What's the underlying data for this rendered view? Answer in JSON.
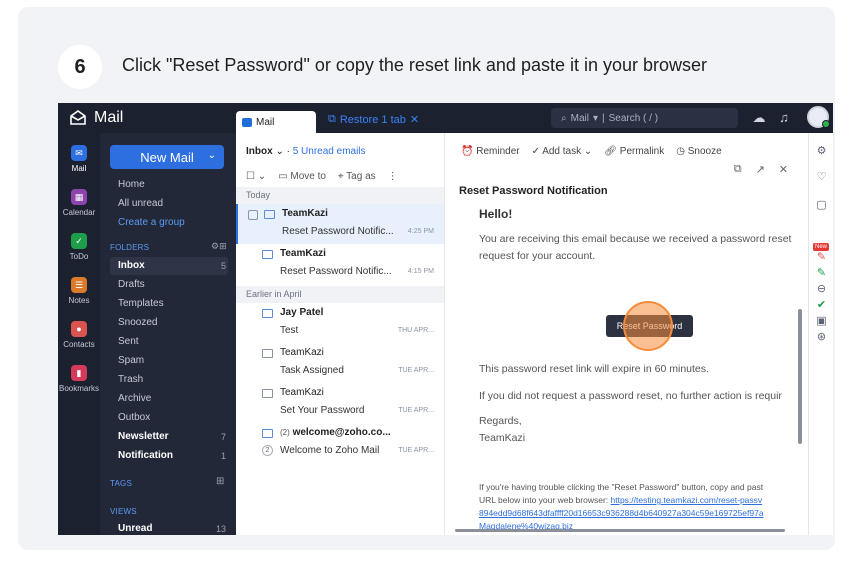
{
  "step": {
    "number": "6",
    "instruction": "Click \"Reset Password\" or copy the reset link and paste it in your browser"
  },
  "topbar": {
    "brand": "Mail",
    "tab_mail": "Mail",
    "tab_restore": "Restore 1 tab",
    "search_scope": "Mail",
    "search_placeholder": "Search ( / )"
  },
  "rail": [
    {
      "label": "Mail",
      "icon": "mail-icon",
      "color": "#2e6fe0"
    },
    {
      "label": "Calendar",
      "icon": "calendar-icon",
      "color": "#8e44ad"
    },
    {
      "label": "ToDo",
      "icon": "todo-icon",
      "color": "#1e9e4a"
    },
    {
      "label": "Notes",
      "icon": "notes-icon",
      "color": "#d97b2b"
    },
    {
      "label": "Contacts",
      "icon": "contacts-icon",
      "color": "#d9534f"
    },
    {
      "label": "Bookmarks",
      "icon": "bookmark-icon",
      "color": "#d63a5a"
    }
  ],
  "folders": {
    "new_mail": "New Mail",
    "top_items": [
      "Home",
      "All unread",
      "Create a group"
    ],
    "section_folders": "FOLDERS",
    "items": [
      {
        "label": "Inbox",
        "count": "5"
      },
      {
        "label": "Drafts",
        "count": ""
      },
      {
        "label": "Templates",
        "count": ""
      },
      {
        "label": "Snoozed",
        "count": ""
      },
      {
        "label": "Sent",
        "count": ""
      },
      {
        "label": "Spam",
        "count": ""
      },
      {
        "label": "Trash",
        "count": ""
      },
      {
        "label": "Archive",
        "count": ""
      },
      {
        "label": "Outbox",
        "count": ""
      },
      {
        "label": "Newsletter",
        "count": "7"
      },
      {
        "label": "Notification",
        "count": "1"
      }
    ],
    "section_tags": "TAGS",
    "section_views": "VIEWS",
    "views": [
      {
        "label": "Unread",
        "count": "13"
      }
    ]
  },
  "list": {
    "folder": "Inbox",
    "unread": "5 Unread emails",
    "move_to": "Move to",
    "tag_as": "Tag as",
    "group_today": "Today",
    "group_april": "Earlier in April",
    "rows": [
      {
        "from": "TeamKazi",
        "subject": "Reset Password Notific...",
        "time": "4:25 PM",
        "bold": true
      },
      {
        "from": "TeamKazi",
        "subject": "Reset Password Notific...",
        "time": "4:15 PM",
        "bold": true
      },
      {
        "from": "Jay Patel",
        "subject": "Test",
        "time": "THU APR...",
        "bold": true
      },
      {
        "from": "TeamKazi",
        "subject": "Task Assigned",
        "time": "TUE APR...",
        "bold": false
      },
      {
        "from": "TeamKazi",
        "subject": "Set Your Password",
        "time": "TUE APR...",
        "bold": false
      },
      {
        "from": "welcome@zoho.co...",
        "subject": "Welcome to Zoho Mail",
        "time": "TUE APR...",
        "bold": true,
        "count_prefix": "(2)",
        "thread": "2"
      }
    ]
  },
  "reader": {
    "tools": [
      "Reminder",
      "Add task",
      "Permalink",
      "Snooze"
    ],
    "subject": "Reset Password Notification",
    "hello": "Hello!",
    "p1a": "You are receiving this email because we received a password reset",
    "p1b": "request for your account.",
    "button": "Reset Password",
    "p2": "This password reset link will expire in 60 minutes.",
    "p3": "If you did not request a password reset, no further action is requir",
    "regards": "Regards,",
    "signature": "TeamKazi",
    "trouble_a": "If you're having trouble clicking the \"Reset Password\" button, copy and past",
    "trouble_b": "URL below into your web browser: ",
    "url_a": "https://testing.teamkazi.com/reset-passv",
    "url_b": "894edd9d68f643dfaffff20d16653c936288d4b640927a304c59e169725ef97a",
    "url_c": "Magdalene%40wizag.biz"
  }
}
